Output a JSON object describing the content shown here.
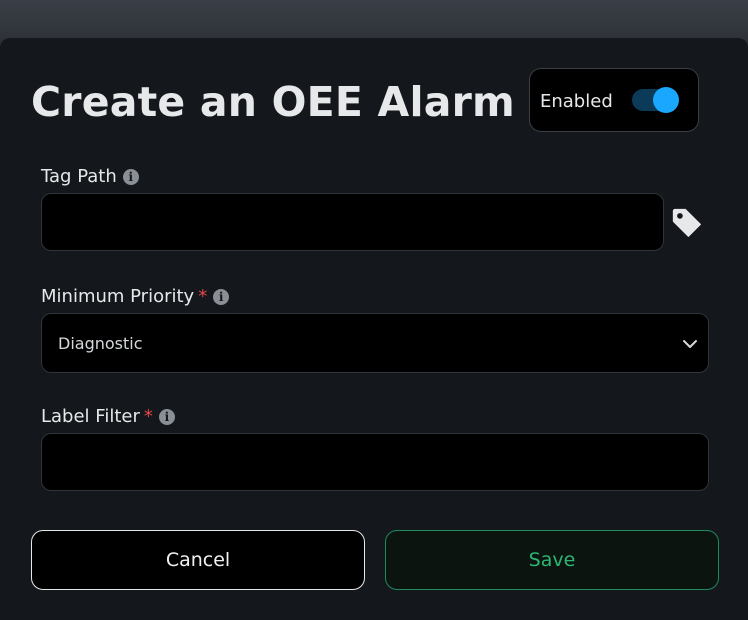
{
  "dialog": {
    "title": "Create an OEE Alarm",
    "enabled_label": "Enabled",
    "enabled": true
  },
  "fields": {
    "tag_path": {
      "label": "Tag Path",
      "value": "",
      "required": false
    },
    "minimum_priority": {
      "label": "Minimum Priority",
      "value": "Diagnostic",
      "required": true
    },
    "label_filter": {
      "label": "Label Filter",
      "value": "",
      "required": true
    }
  },
  "required_marker": "*",
  "info_glyph": "i",
  "buttons": {
    "cancel": "Cancel",
    "save": "Save"
  },
  "icons": {
    "info": "info-icon",
    "tag": "tag-icon",
    "chevron": "chevron-down-icon"
  },
  "colors": {
    "accent_toggle": "#1aa7ff",
    "save": "#2bb673",
    "required": "#e5484d"
  }
}
